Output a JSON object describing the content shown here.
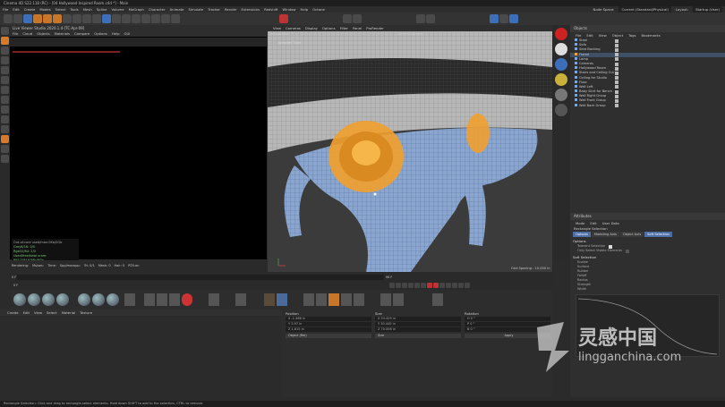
{
  "window": {
    "title": "Cinema 4D S22.118 (RC) - [04 Hollywood Inspired Room.c4d *] - Main"
  },
  "menubar": [
    "File",
    "Edit",
    "Create",
    "Modes",
    "Select",
    "Tools",
    "Mesh",
    "Spline",
    "Volume",
    "MoGraph",
    "Character",
    "Animate",
    "Simulate",
    "Tracker",
    "Render",
    "Extensions",
    "Redshift",
    "Window",
    "Help",
    "Octane"
  ],
  "layout": {
    "node_space_label": "Node Space:",
    "node_space_value": "Current (Standard/Physical)",
    "layout_label": "Layout:",
    "layout_value": "Startup (User)"
  },
  "live_viewer": {
    "title": "Live Viewer Studio 2020.1.4-[TC-Apr-09]",
    "menu": [
      "File",
      "Cloud",
      "Objects",
      "Materials",
      "Compare",
      "Options",
      "Help",
      "GUI"
    ],
    "status_lines": [
      "Out-of-core used/max:0Kb/0Gb",
      "Grey8/16: 0/0",
      "Rgb32/64: 2/0",
      "Used/free/total vram: 891/7/8191Mb/8Gb"
    ],
    "bottom": [
      "Rendering:",
      "Ms/sec:",
      "Time:",
      "Spp/maxspp:",
      "Tri: 0/1",
      "Mesh: 0",
      "Hair: 0",
      "RTX:on"
    ]
  },
  "viewport": {
    "menu": [
      "View",
      "Cameras",
      "Display",
      "Options",
      "Filter",
      "Panel",
      "ProRender"
    ],
    "perspective": "Perspective",
    "camera": "Default Camera",
    "selected_label": "Selected Total",
    "grid_spacing": "Grid Spacing : 10.000 in"
  },
  "objects": {
    "title": "Objects",
    "menu": [
      "File",
      "Edit",
      "View",
      "Object",
      "Tags",
      "Bookmarks"
    ],
    "rows": [
      {
        "name": "Stool",
        "selected": false
      },
      {
        "name": "Sofa",
        "selected": false
      },
      {
        "name": "Seat Backing",
        "selected": false
      },
      {
        "name": "Frame",
        "selected": true
      },
      {
        "name": "Lamp",
        "selected": false
      },
      {
        "name": "Cameras",
        "selected": false
      },
      {
        "name": "Hollywood Room",
        "selected": false
      },
      {
        "name": "Stairs and Ceiling Cut",
        "selected": false
      },
      {
        "name": "Ceiling for Studio",
        "selected": false
      },
      {
        "name": "Floor",
        "selected": false
      },
      {
        "name": "Wall Left",
        "selected": false
      },
      {
        "name": "Baby Skirt for Bench",
        "selected": false
      },
      {
        "name": "Wall Right Group",
        "selected": false
      },
      {
        "name": "Wall Front Group",
        "selected": false
      },
      {
        "name": "Wall Back Group",
        "selected": false
      }
    ]
  },
  "attributes": {
    "title": "Attributes",
    "menu": [
      "Mode",
      "Edit",
      "User Data"
    ],
    "tool": "Rectangle Selection",
    "tabs": [
      {
        "label": "Options",
        "active": true
      },
      {
        "label": "Modeling Axis",
        "active": false
      },
      {
        "label": "Object Axis",
        "active": false
      },
      {
        "label": "Soft Selection",
        "active": true
      }
    ],
    "options_heading": "Options",
    "options": [
      "Tolerant Selection",
      "Only Select Visible Elements"
    ],
    "soft_heading": "Soft Selection",
    "soft": [
      "Enable",
      "Surface",
      "Rubber",
      "Falloff",
      "Radius",
      "Strength",
      "Width"
    ]
  },
  "timeline": {
    "start": "0 F",
    "end": "90 F",
    "current": "0 F"
  },
  "materials": {
    "menu": [
      "Create",
      "Edit",
      "View",
      "Select",
      "Material",
      "Texture"
    ]
  },
  "coordinates": {
    "position": {
      "header": "Position",
      "x": "X  -1.466 in",
      "y": "Y  3.97 in",
      "z": "Z  1.815 in"
    },
    "size": {
      "header": "Size",
      "x": "X  53.429 in",
      "y": "Y  30.445 in",
      "z": "Z  70.006 in"
    },
    "rotation": {
      "header": "Rotation",
      "x": "H  0 °",
      "y": "P  0 °",
      "z": "B  0 °"
    },
    "mode": "Object (Rel)",
    "size_mode": "Size",
    "apply": "Apply"
  },
  "statusbar": "Rectangle Selection: Click and drag to rectangle-select elements. Hold down SHIFT to add to the selection, CTRL to remove.",
  "watermark": {
    "brand": "灵感中国",
    "url": "lingganchina.com"
  },
  "colors": {
    "accent_blue": "#3d6fb8",
    "selection_orange": "#f0a030",
    "mesh_blue": "#6e8fc0"
  }
}
